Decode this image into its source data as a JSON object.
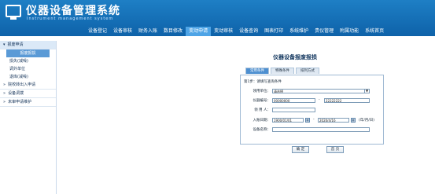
{
  "header": {
    "title": "仪器设备管理系统",
    "subtitle": "Instrument management system",
    "nav": [
      "设备登记",
      "设备审核",
      "财务入账",
      "数目修改",
      "变动申请",
      "变动审核",
      "设备查询",
      "图表打印",
      "系统维护",
      "贵仪管理",
      "附属功能",
      "系统首页"
    ],
    "active_index": 4
  },
  "sidebar": {
    "sections": [
      {
        "label": "报废申请",
        "open": true,
        "children": [
          "报废报损",
          "损失(减噪)",
          "调外单位",
          "退库(减噪)"
        ],
        "active_child": 0
      },
      {
        "label": "院校转出入申请",
        "open": false,
        "children": []
      },
      {
        "label": "设备调拨",
        "open": false,
        "children": []
      },
      {
        "label": "未审申请维护",
        "open": false,
        "children": []
      }
    ]
  },
  "main": {
    "title": "仪器设备报废报损",
    "tabs": [
      "常用条件",
      "特殊条件",
      "排列方式"
    ],
    "active_tab": 0,
    "panel_heading": "第1步：请填写查询条件",
    "form": {
      "unit_label": "领用单位：",
      "unit_value": "请选择",
      "code_label": "仪器编号：",
      "code_from": "00000000",
      "dash": "-",
      "code_to": "22222222",
      "user_label": "领  用  人：",
      "user_value": "",
      "date_label": "入账日期：",
      "date_from": "1900/01/01",
      "date_to": "2020/4/16",
      "date_hint": "(年/月/日)",
      "name_label": "设备名称：",
      "name_value": ""
    },
    "buttons": {
      "ok": "确 定",
      "home": "首 页"
    }
  }
}
